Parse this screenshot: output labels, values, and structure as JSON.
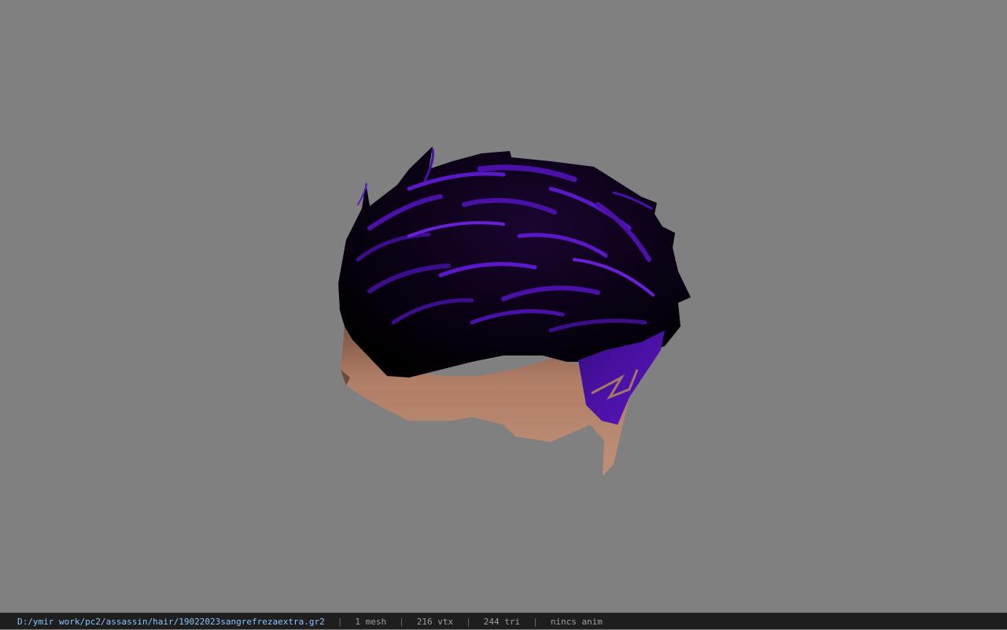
{
  "viewport": {
    "background": "#808080",
    "model_name": "hair mesh"
  },
  "colors": {
    "hair_dark": "#000000",
    "hair_purple": "#4b10a8",
    "hair_highlight": "#6a1fd6",
    "skin": "#b4826a",
    "status_bg": "#1e1e1e",
    "path_color": "#8ec5ff"
  },
  "status": {
    "path": "D:/ymir work/pc2/assassin/hair/19022023sangrefrezaextra.gr2",
    "sep": "|",
    "mesh": "1 mesh",
    "vtx": "216 vtx",
    "tri": "244 tri",
    "anim": "nincs anim"
  }
}
